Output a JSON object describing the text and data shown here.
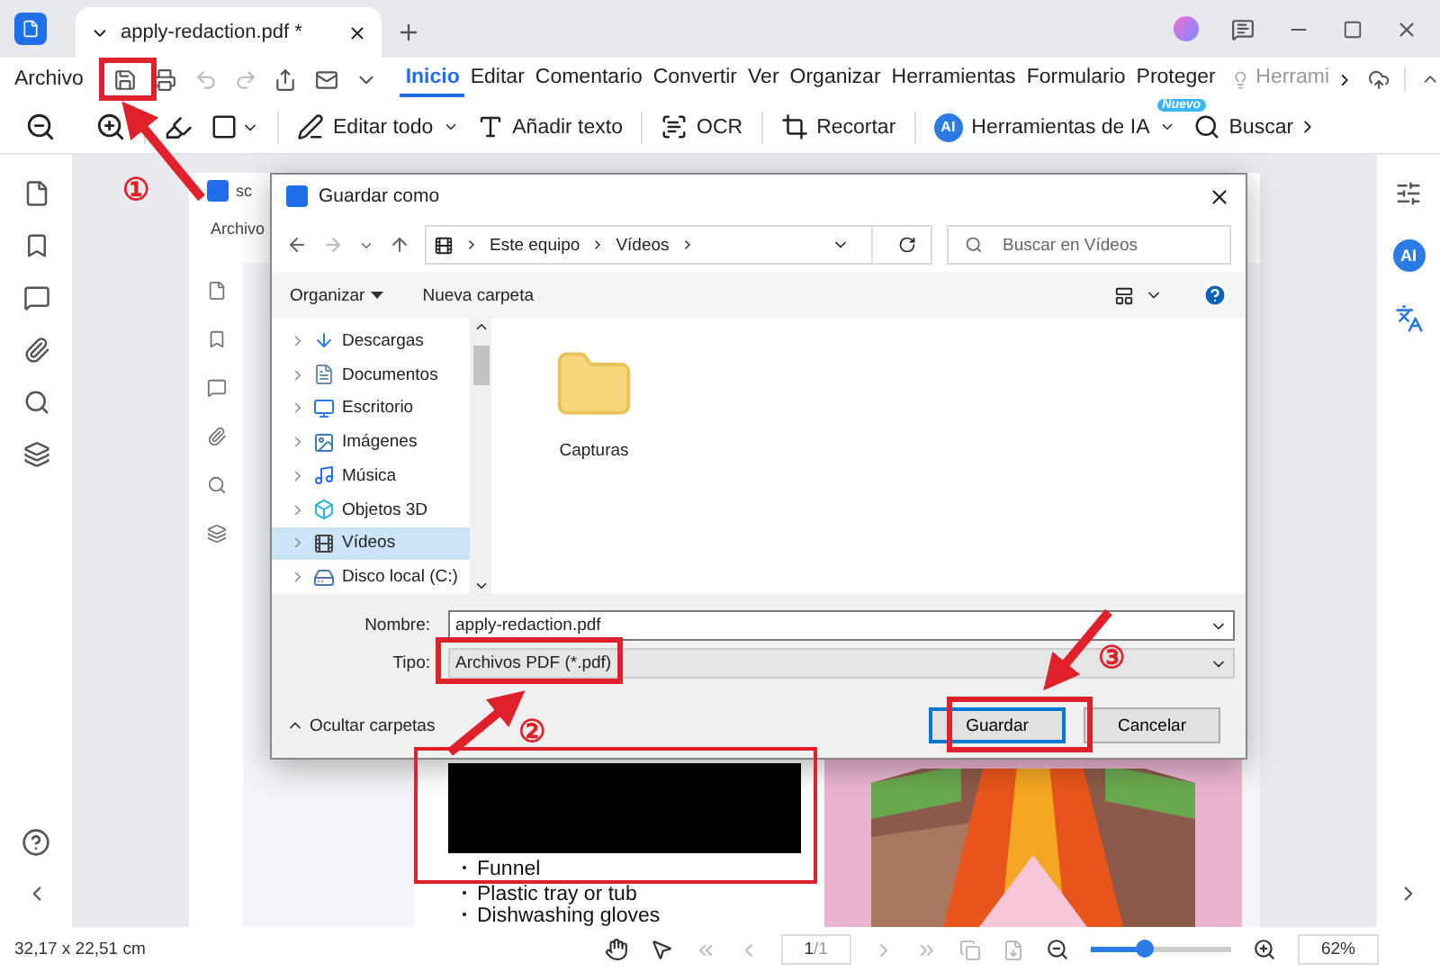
{
  "app_tab": {
    "title": "apply-redaction.pdf *"
  },
  "menu": {
    "file": "Archivo",
    "items": [
      {
        "label": "Inicio",
        "selected": true
      },
      {
        "label": "Editar",
        "selected": false
      },
      {
        "label": "Comentario",
        "selected": false
      },
      {
        "label": "Convertir",
        "selected": false
      },
      {
        "label": "Ver",
        "selected": false
      },
      {
        "label": "Organizar",
        "selected": false
      },
      {
        "label": "Herramientas",
        "selected": false
      },
      {
        "label": "Formulario",
        "selected": false
      },
      {
        "label": "Proteger",
        "selected": false
      },
      {
        "label": "Herrami",
        "selected": false
      }
    ]
  },
  "toolbar": [
    {
      "kind": "edit",
      "label": "Editar todo"
    },
    {
      "kind": "text",
      "label": "Añadir texto"
    },
    {
      "kind": "ocr",
      "label": "OCR"
    },
    {
      "kind": "crop",
      "label": "Recortar"
    },
    {
      "kind": "ai",
      "label": "Herramientas de IA",
      "icon_text": "AI",
      "badge": "Nuevo"
    },
    {
      "kind": "search",
      "label": "Buscar"
    }
  ],
  "right_sidebar": {
    "ai_text": "AI"
  },
  "background_doc": {
    "menu": "Archivo",
    "tab_text": "sc",
    "list": [
      "Funnel",
      "Plastic tray or tub",
      "Dishwashing gloves"
    ]
  },
  "dialog": {
    "title": "Guardar como",
    "path": [
      "Este equipo",
      "Vídeos"
    ],
    "search_placeholder": "Buscar en Vídeos",
    "organize": "Organizar",
    "new_folder": "Nueva carpeta",
    "nav": [
      {
        "kind": "download",
        "label": "Descargas",
        "selected": false
      },
      {
        "kind": "docs",
        "label": "Documentos",
        "selected": false
      },
      {
        "kind": "desktop",
        "label": "Escritorio",
        "selected": false
      },
      {
        "kind": "image",
        "label": "Imágenes",
        "selected": false
      },
      {
        "kind": "music",
        "label": "Música",
        "selected": false
      },
      {
        "kind": "cube",
        "label": "Objetos 3D",
        "selected": false
      },
      {
        "kind": "video",
        "label": "Vídeos",
        "selected": true
      },
      {
        "kind": "disk",
        "label": "Disco local (C:)",
        "selected": false
      }
    ],
    "folders": [
      "Capturas"
    ],
    "filename_label": "Nombre:",
    "filename": "apply-redaction.pdf",
    "type_label": "Tipo:",
    "type": "Archivos PDF (*.pdf)",
    "hide_folders": "Ocultar carpetas",
    "buttons": [
      {
        "kind": "primary",
        "label": "Guardar"
      },
      {
        "kind": "secondary",
        "label": "Cancelar"
      }
    ]
  },
  "callouts": [
    "①",
    "②",
    "③"
  ],
  "status_bar": {
    "dimensions": "32,17 x 22,51 cm",
    "page": "1",
    "total": "/1",
    "zoom": "62%",
    "zoom_slider": {
      "level": 0.38
    }
  }
}
